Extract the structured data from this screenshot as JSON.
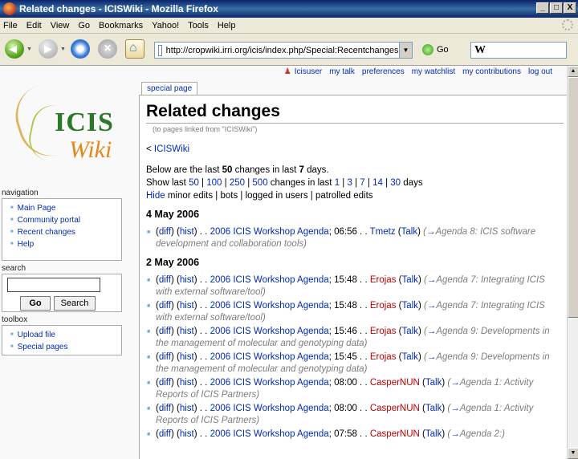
{
  "window": {
    "title": "Related changes - ICISWiki - Mozilla Firefox",
    "min": "_",
    "max": "□",
    "close": "X"
  },
  "menu": [
    "File",
    "Edit",
    "View",
    "Go",
    "Bookmarks",
    "Yahoo!",
    "Tools",
    "Help"
  ],
  "nav": {
    "url": "http://cropwiki.irri.org/icis/index.php/Special:Recentchangeslink",
    "go": "Go",
    "search_value": "W"
  },
  "personal_tools": [
    "Icisuser",
    "my talk",
    "preferences",
    "my watchlist",
    "my contributions",
    "log out"
  ],
  "logo": {
    "line1": "ICIS",
    "line2": "Wiki"
  },
  "sidebar": {
    "navigation_title": "navigation",
    "navigation": [
      "Main Page",
      "Community portal",
      "Recent changes",
      "Help"
    ],
    "search_title": "search",
    "go_btn": "Go",
    "search_btn": "Search",
    "toolbox_title": "toolbox",
    "toolbox": [
      "Upload file",
      "Special pages"
    ]
  },
  "tab": "special page",
  "page": {
    "title": "Related changes",
    "subtitle": "(to pages linked from \"ICISWiki\")",
    "backlink_prefix": "< ",
    "backlink": "ICISWiki",
    "summary_pre": "Below are the last ",
    "summary_count": "50",
    "summary_mid": " changes in last ",
    "summary_days": "7",
    "summary_post": " days.",
    "show_last": "Show last ",
    "limits": [
      "50",
      "100",
      "250",
      "500"
    ],
    "changes_in_last": " changes in last ",
    "days_opts": [
      "1",
      "3",
      "7",
      "14",
      "30"
    ],
    "days_word": " days",
    "hide": "Hide",
    "hide_rest": " minor edits | bots | logged in users | patrolled edits"
  },
  "days": [
    {
      "date": "4 May 2006",
      "entries": [
        {
          "page": "2006 ICIS Workshop Agenda",
          "time": "06:56",
          "user": "Tmetz",
          "user_red": false,
          "comment": "Agenda 8: ICIS software development and collaboration tools"
        }
      ]
    },
    {
      "date": "2 May 2006",
      "entries": [
        {
          "page": "2006 ICIS Workshop Agenda",
          "time": "15:48",
          "user": "Erojas",
          "user_red": true,
          "comment": "Agenda 7: Integrating ICIS with external software/tool"
        },
        {
          "page": "2006 ICIS Workshop Agenda",
          "time": "15:48",
          "user": "Erojas",
          "user_red": true,
          "comment": "Agenda 7: Integrating ICIS with external software/tool"
        },
        {
          "page": "2006 ICIS Workshop Agenda",
          "time": "15:46",
          "user": "Erojas",
          "user_red": true,
          "comment": "Agenda 9: Developments in the management of molecular and genotyping data"
        },
        {
          "page": "2006 ICIS Workshop Agenda",
          "time": "15:45",
          "user": "Erojas",
          "user_red": true,
          "comment": "Agenda 9: Developments in the management of molecular and genotyping data"
        },
        {
          "page": "2006 ICIS Workshop Agenda",
          "time": "08:00",
          "user": "CasperNUN",
          "user_red": true,
          "comment": "Agenda 1: Activity Reports of ICIS Partners"
        },
        {
          "page": "2006 ICIS Workshop Agenda",
          "time": "08:00",
          "user": "CasperNUN",
          "user_red": true,
          "comment": "Agenda 1: Activity Reports of ICIS Partners"
        },
        {
          "page": "2006 ICIS Workshop Agenda",
          "time": "07:58",
          "user": "CasperNUN",
          "user_red": true,
          "comment": "Agenda 2:"
        }
      ]
    }
  ],
  "labels": {
    "diff": "diff",
    "hist": "hist",
    "talk": "Talk",
    "sep": " . . ",
    "arrow": "→"
  }
}
